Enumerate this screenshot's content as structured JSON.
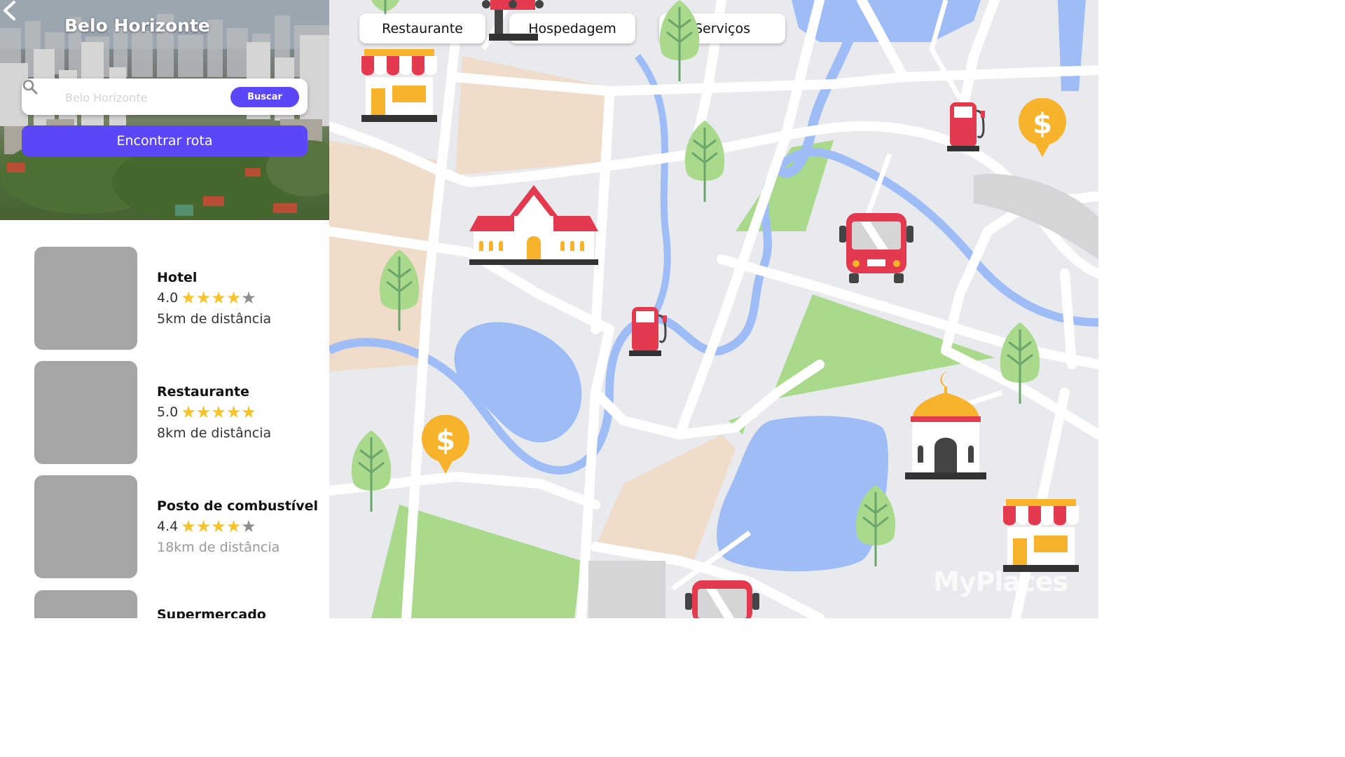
{
  "header": {
    "city_title": "Belo Horizonte",
    "back_icon": "chevron-left-icon"
  },
  "search": {
    "placeholder": "Belo Horizonte",
    "button_label": "Buscar",
    "icon": "search-icon"
  },
  "route_button_label": "Encontrar rota",
  "places": [
    {
      "name": "Hotel",
      "rating": "4.0",
      "stars_filled": 4,
      "distance": "5km de distância"
    },
    {
      "name": "Restaurante",
      "rating": "5.0",
      "stars_filled": 5,
      "distance": "8km de distância"
    },
    {
      "name": "Posto de combustível",
      "rating": "4.4",
      "stars_filled": 4,
      "distance": "18km de distância"
    },
    {
      "name": "Supermercado"
    }
  ],
  "map": {
    "filters": [
      "Restaurante",
      "Hospedagem",
      "Serviços"
    ],
    "watermark": "MyPlaces",
    "colors": {
      "accent": "#5a47f7",
      "road": "#ffffff",
      "background": "#e9eaed",
      "water": "#9ebcf5",
      "park": "#a9d98a",
      "sand": "#efdccb",
      "star": "#f7c22a",
      "marker_red": "#e43a4f",
      "marker_yellow": "#f7b32b"
    }
  }
}
